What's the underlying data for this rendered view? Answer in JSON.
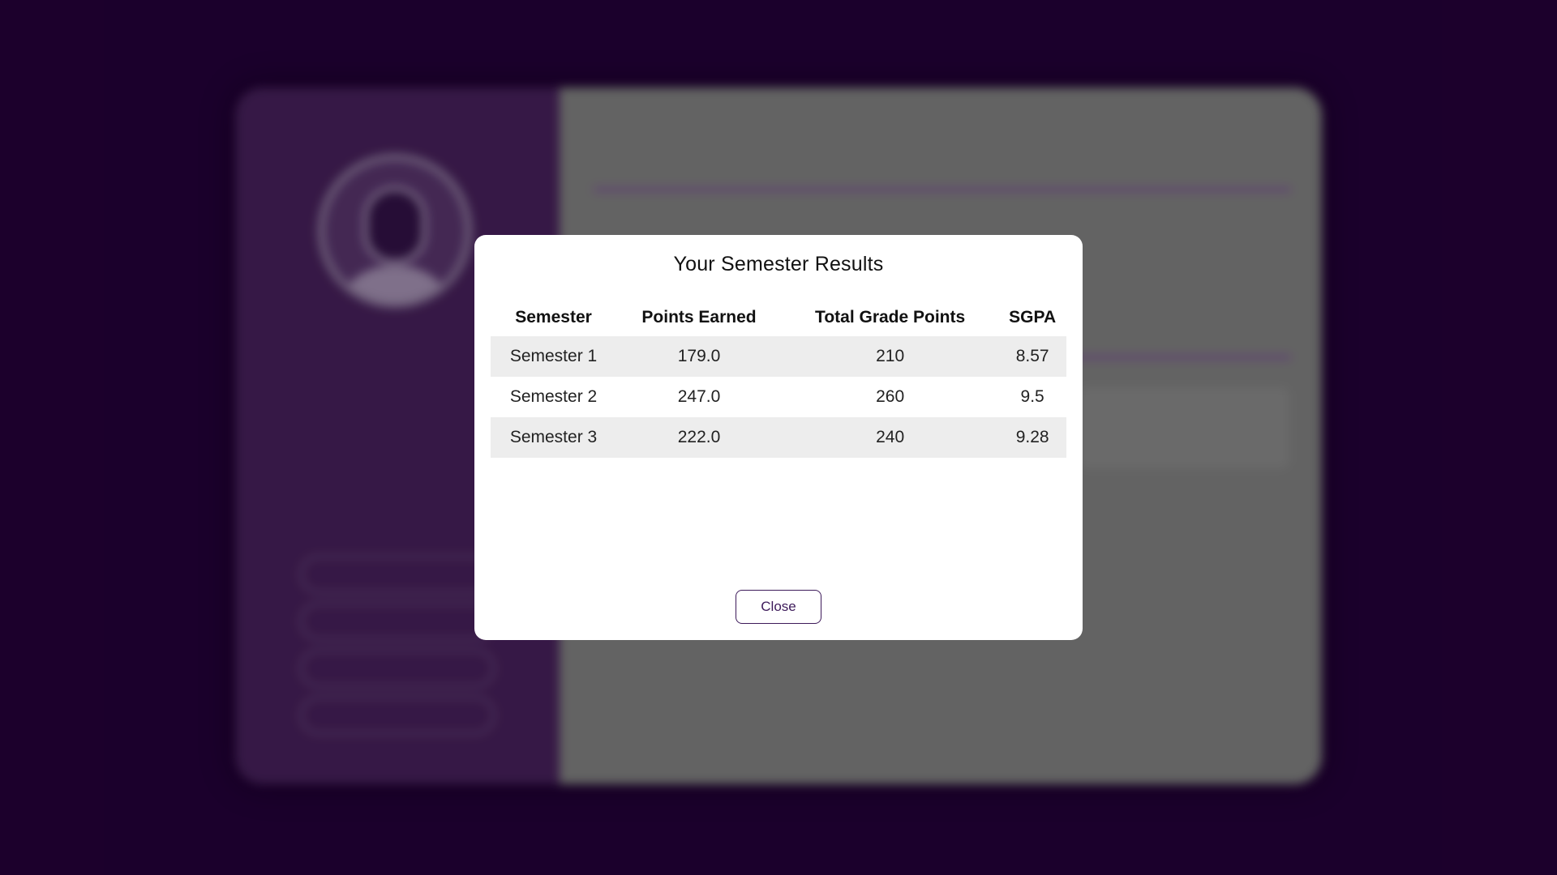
{
  "modal": {
    "title": "Your Semester Results",
    "columns": [
      "Semester",
      "Points Earned",
      "Total Grade Points",
      "SGPA"
    ],
    "rows": [
      [
        "Semester 1",
        "179.0",
        "210",
        "8.57"
      ],
      [
        "Semester 2",
        "247.0",
        "260",
        "9.5"
      ],
      [
        "Semester 3",
        "222.0",
        "240",
        "9.28"
      ]
    ],
    "close_label": "Close"
  },
  "colors": {
    "page_background": "#1e0030",
    "accent": "#3d1a5a",
    "row_shade": "#ededed"
  }
}
